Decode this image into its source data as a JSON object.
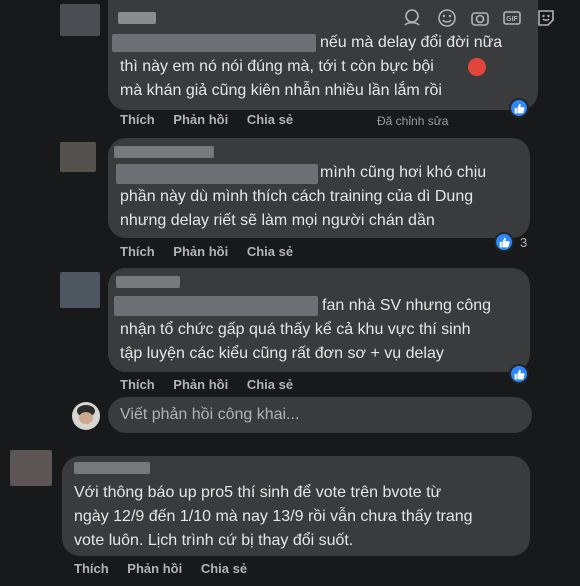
{
  "comments": [
    {
      "text": "nếu mà delay đổi đời nữa\nthì này em nó nói đúng mà, tới t còn bực bội\nmà khán giả cũng kiên nhẫn nhiều lần lắm rồi",
      "emoji": "angry-emoji",
      "actions": [
        "Thích",
        "Phản hồi",
        "Chia sẻ"
      ],
      "edited": "Đã chỉnh sửa",
      "reaction": "like"
    },
    {
      "text": "mình cũng hơi khó chịu\nphần này dù mình thích cách training của dì Dung\nnhưng delay riết sẽ làm mọi người chán dần",
      "actions": [
        "Thích",
        "Phản hồi",
        "Chia sẻ"
      ],
      "reaction": "like",
      "reaction_count": "3"
    },
    {
      "text": "fan nhà SV nhưng công\nnhận tổ chức gấp quá thấy kể cả khu vực thí sinh\ntập luyện các kiểu cũng rất đơn sơ + vụ delay",
      "actions": [
        "Thích",
        "Phản hồi",
        "Chia sẻ"
      ],
      "reaction": "like"
    },
    {
      "text": "Với thông báo up pro5 thí sinh để vote trên bvote từ\nngày 12/9 đến 1/10 mà nay 13/9 rồi vẫn chưa thấy trang\nvote luôn. Lịch trình cứ bị thay đổi suốt.",
      "actions": [
        "Thích",
        "Phản hồi",
        "Chia sẻ"
      ]
    }
  ],
  "reply_box": {
    "placeholder": "Viết phản hồi công khai...",
    "icons": [
      "avatar-sticker-icon",
      "emoji-icon",
      "camera-icon",
      "gif-icon",
      "sticker-icon"
    ]
  },
  "colors": {
    "background": "#18191a",
    "bubble": "#3a3b3c",
    "like_blue": "#2d88ff",
    "muted": "#b0b3b8"
  }
}
